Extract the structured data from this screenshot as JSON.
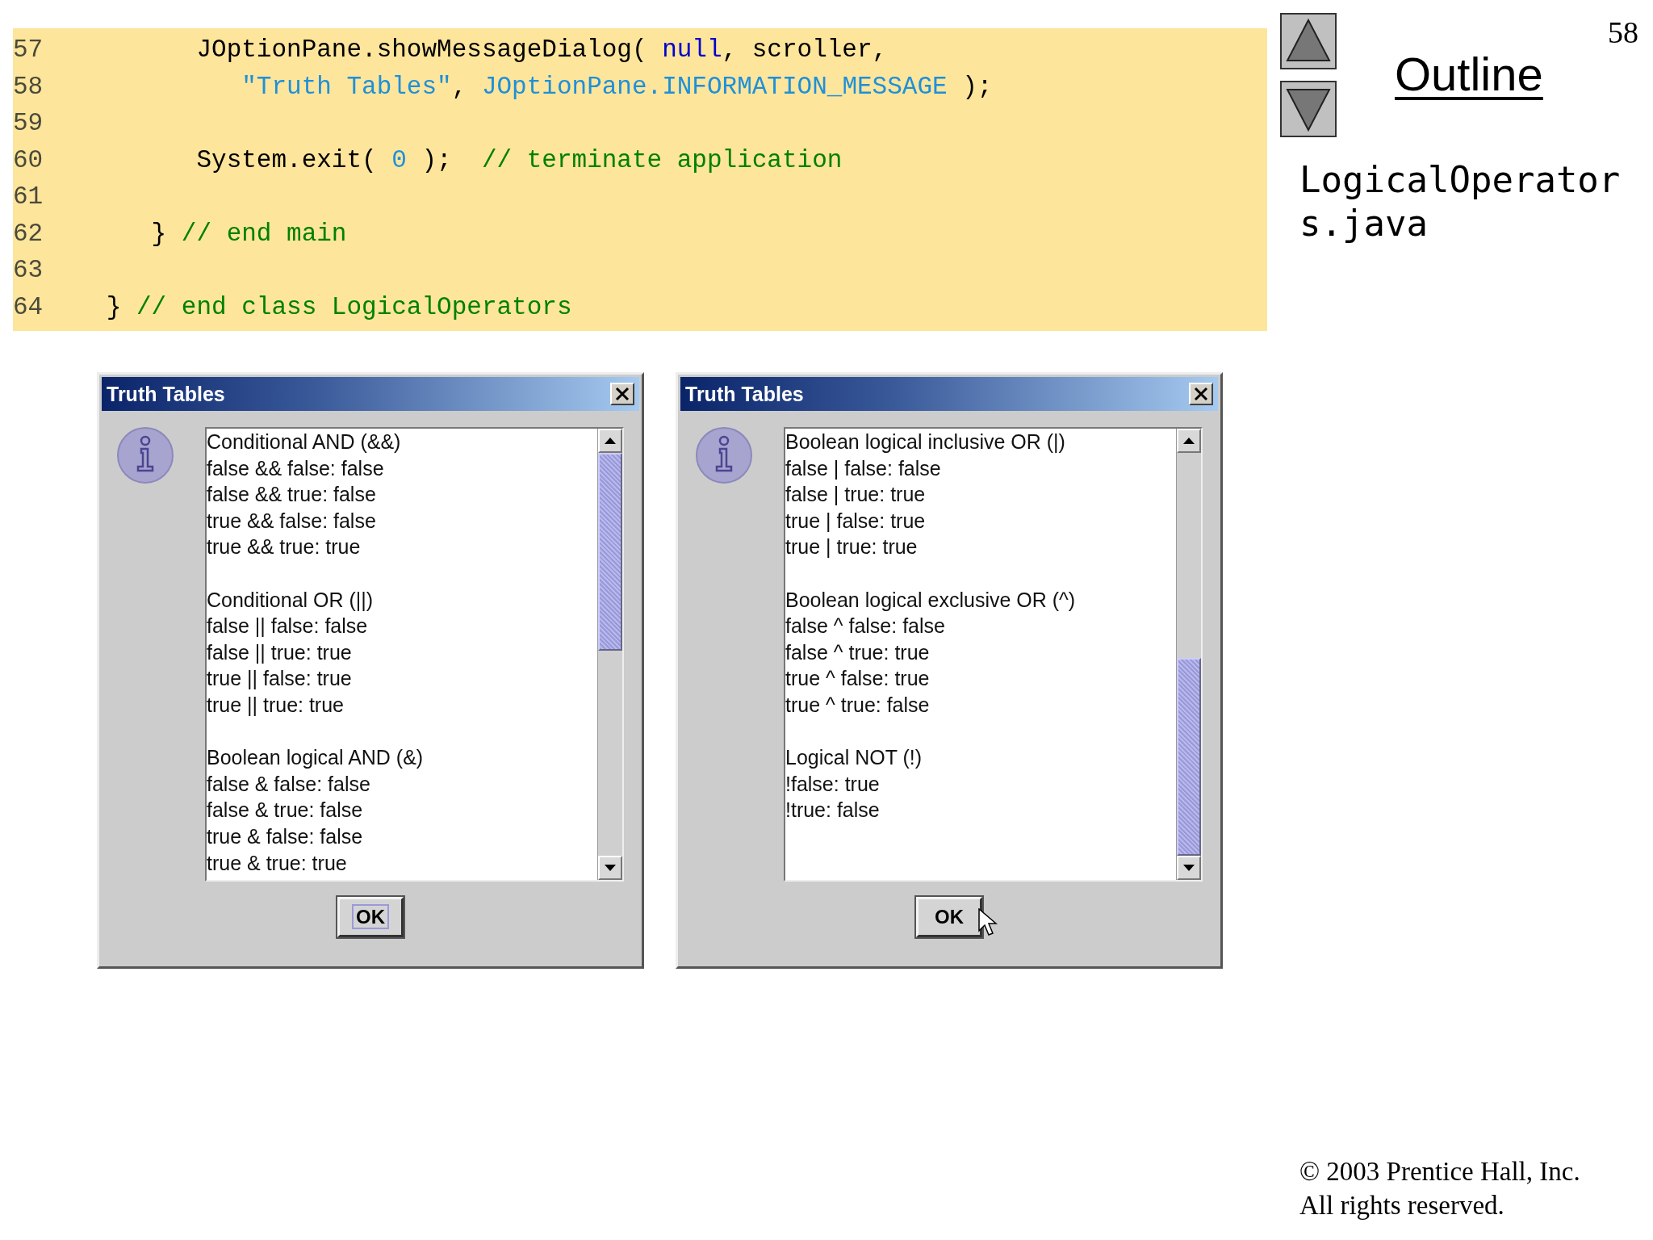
{
  "code": {
    "lines": [
      {
        "number": "57",
        "segments": [
          {
            "kind": "plain",
            "text": "         JOptionPane.showMessageDialog( "
          },
          {
            "kind": "keyword",
            "text": "null"
          },
          {
            "kind": "plain",
            "text": ", scroller,"
          }
        ]
      },
      {
        "number": "58",
        "segments": [
          {
            "kind": "string",
            "text": "            \"Truth Tables\""
          },
          {
            "kind": "plain",
            "text": ", "
          },
          {
            "kind": "constant",
            "text": "JOptionPane.INFORMATION_MESSAGE"
          },
          {
            "kind": "plain",
            "text": " );"
          }
        ]
      },
      {
        "number": "59"
      },
      {
        "number": "60",
        "segments": [
          {
            "kind": "plain",
            "text": "         System.exit( "
          },
          {
            "kind": "constant",
            "text": "0"
          },
          {
            "kind": "plain",
            "text": " );  "
          },
          {
            "kind": "comment",
            "text": "// terminate application"
          }
        ]
      },
      {
        "number": "61"
      },
      {
        "number": "62",
        "segments": [
          {
            "kind": "plain",
            "text": "      } "
          },
          {
            "kind": "comment",
            "text": "// end main"
          }
        ]
      },
      {
        "number": "63"
      },
      {
        "number": "64",
        "segments": [
          {
            "kind": "plain",
            "text": "   } "
          },
          {
            "kind": "comment",
            "text": "// end class LogicalOperators"
          }
        ]
      }
    ]
  },
  "dialogs": [
    {
      "title": "Truth Tables",
      "scrolled_to_bottom": false,
      "button": {
        "label": "OK",
        "focused": true
      },
      "pointer_over_button": false,
      "sections": [
        {
          "lines": [
            "Conditional AND (&&)",
            "false && false: false",
            "false && true: false",
            "true && false: false",
            "true && true: true"
          ]
        },
        {
          "lines": [
            "Conditional OR (||)",
            "false || false: false",
            "false || true: true",
            "true || false: true",
            "true || true: true"
          ]
        },
        {
          "lines": [
            "Boolean logical AND (&)",
            "false & false: false",
            "false & true: false",
            "true & false: false",
            "true & true: true"
          ]
        }
      ]
    },
    {
      "title": "Truth Tables",
      "scrolled_to_bottom": true,
      "button": {
        "label": "OK",
        "focused": false
      },
      "pointer_over_button": true,
      "sections": [
        {
          "lines": [
            "Boolean logical inclusive OR (|)",
            "false | false: false",
            "false | true: true",
            "true | false: true",
            "true | true: true"
          ]
        },
        {
          "lines": [
            "Boolean logical exclusive OR (^)",
            "false ^ false: false",
            "false ^ true: true",
            "true ^ false: true",
            "true ^ true: false"
          ]
        },
        {
          "lines": [
            "Logical NOT (!)",
            "!false: true",
            "!true: false"
          ]
        }
      ]
    }
  ],
  "sidebar": {
    "page_number": "58",
    "heading": "Outline",
    "file_name": "LogicalOperators.java"
  },
  "footer": {
    "lines": [
      "© 2003 Prentice Hall, Inc.",
      "All rights reserved."
    ]
  }
}
